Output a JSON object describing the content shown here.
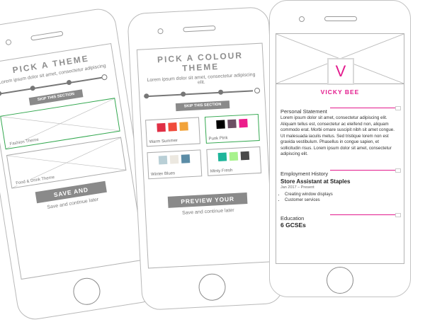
{
  "phone1": {
    "title": "PICK A THEME",
    "subtitle": "Lorem ipsum dolor sit amet, consectetur adipiscing",
    "skip": "SKIP THIS SECTION",
    "themes": [
      {
        "label": "Fashion Theme",
        "selected": true
      },
      {
        "label": "Food & Drink Theme",
        "selected": false
      }
    ],
    "primary_button": "SAVE AND CONTINUE",
    "later": "Save and continue later"
  },
  "phone2": {
    "title": "PICK A COLOUR THEME",
    "subtitle": "Lorem ipsum dolor sit amet, consectetur adipiscing elit.",
    "skip": "SKIP THIS SECTION",
    "palettes": [
      {
        "label": "Warm Summer",
        "colors": [
          "#e02f45",
          "#f04b3b",
          "#f2a33a"
        ],
        "selected": false
      },
      {
        "label": "Punk Pink",
        "colors": [
          "#000000",
          "#6b4f63",
          "#ec1e8b"
        ],
        "selected": true
      },
      {
        "label": "Winter Blues",
        "colors": [
          "#b9cfd6",
          "#ece8e0",
          "#5b8ca6"
        ],
        "selected": false
      },
      {
        "label": "Minty Fresh",
        "colors": [
          "#1fb59a",
          "#a8f28d",
          "#4a4a4a"
        ],
        "selected": false
      }
    ],
    "primary_button": "PREVIEW YOUR PROFILE",
    "later": "Save and continue later"
  },
  "phone3": {
    "avatar_letter": "V",
    "name": "VICKY BEE",
    "sections": {
      "personal": "Personal Statement",
      "employment": "Employment History",
      "education": "Education"
    },
    "statement": "Lorem ipsum dolor sit amet, consectetur adipiscing elit. Aliquam tellus est, consectetur ac eleifend non, aliquam commodo erat. Morbi ornare suscipit nibh sit amet congue. Ut malesuada iaculis metus. Sed tristique lorem non est gravida vestibulum. Phasellus in congue sapien, et sollicitudin risus. Lorem ipsum dolor sit amet, consectetur adipiscing elit.",
    "job": {
      "title": "Store Assistant at Staples",
      "dates": "Jan 2017 – Present",
      "duties": [
        "Creating window displays",
        "Customer services"
      ]
    },
    "education_item": "6 GCSEs"
  },
  "colors": {
    "accent": "#e31a8d",
    "selected_border": "#34a850",
    "button": "#8a8a8a"
  }
}
